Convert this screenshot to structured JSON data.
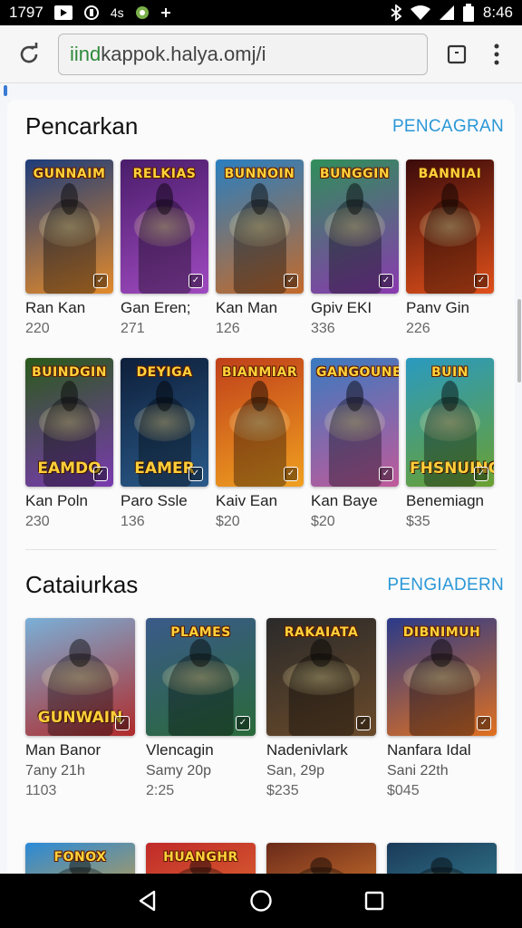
{
  "status_bar": {
    "time_left": "1797",
    "time_right": "8:46",
    "indicator": "4s"
  },
  "browser": {
    "url_prefix": "iind",
    "url_rest": "kappok.halya.omj/i"
  },
  "section1": {
    "title": "Pencarkan",
    "link": "PENCAGRAN",
    "row1": [
      {
        "name": "Ran Kan",
        "num": "220",
        "logo": "GUNNAIM",
        "colors": [
          "#1d3c7a",
          "#e38a2a"
        ]
      },
      {
        "name": "Gan Eren;",
        "num": "271",
        "logo": "RELKIAS",
        "colors": [
          "#4a1d6b",
          "#a04ac0"
        ]
      },
      {
        "name": "Kan Man",
        "num": "126",
        "logo": "BUNNOIN",
        "colors": [
          "#2a7fc0",
          "#c46a2a"
        ]
      },
      {
        "name": "Gpiv EKI",
        "num": "336",
        "logo": "BUNGGIN",
        "colors": [
          "#2f8f5a",
          "#8a3ab0"
        ]
      },
      {
        "name": "Panv Gin",
        "num": "226",
        "logo": "BANNIAI",
        "colors": [
          "#3a0a0a",
          "#e0501a"
        ]
      }
    ],
    "row2": [
      {
        "name": "Kan Poln",
        "num": "230",
        "logo": "BUINDGIN",
        "bottom": "EAMDO",
        "colors": [
          "#2a5a1a",
          "#7a3ab0"
        ]
      },
      {
        "name": "Paro Ssle",
        "num": "136",
        "logo": "DEYIGA",
        "bottom": "EAMER",
        "colors": [
          "#0e1f3a",
          "#2a5a8a"
        ]
      },
      {
        "name": "Kaiv Ean",
        "num": "$20",
        "logo": "BIANMIAR",
        "bottom": "",
        "colors": [
          "#c0401a",
          "#f0a020"
        ]
      },
      {
        "name": "Kan Baye",
        "num": "$20",
        "logo": "GANGOUNEAS",
        "bottom": "",
        "colors": [
          "#3a7ac0",
          "#c05a9a"
        ]
      },
      {
        "name": "Benemiagn",
        "num": "$35",
        "logo": "BUIN",
        "bottom": "FHSNUING",
        "colors": [
          "#2a9ac0",
          "#6aa030"
        ]
      }
    ]
  },
  "section2": {
    "title": "Cataiurkas",
    "link": "PENGIADERN",
    "row": [
      {
        "name": "Man Banor",
        "sub": "7any 21h",
        "num": "1103",
        "logo": "",
        "bottom": "GUNWAIN",
        "colors": [
          "#7ab0d8",
          "#b02a2a"
        ]
      },
      {
        "name": "Vlencagin",
        "sub": "Samy 20p",
        "num": "2:25",
        "logo": "PLAMES",
        "bottom": "",
        "colors": [
          "#3a5a8a",
          "#2a6a3a"
        ]
      },
      {
        "name": "Nadenivlark",
        "sub": "San, 29p",
        "num": "$235",
        "logo": "RAKAIATA",
        "bottom": "",
        "colors": [
          "#2a2a2a",
          "#6a4a2a"
        ]
      },
      {
        "name": "Nanfara Idal",
        "sub": "Sani 22th",
        "num": "$045",
        "logo": "DIBNIMUH",
        "bottom": "",
        "colors": [
          "#2a3a8a",
          "#e07020"
        ]
      }
    ]
  },
  "section3": {
    "row": [
      {
        "logo": "FONOX",
        "colors": [
          "#2a8ad8",
          "#e0a030"
        ]
      },
      {
        "logo": "HUANGHR",
        "colors": [
          "#c02a2a",
          "#e07030"
        ]
      },
      {
        "logo": "",
        "colors": [
          "#6a2a1a",
          "#e08030"
        ]
      },
      {
        "logo": "",
        "colors": [
          "#1a3a5a",
          "#3a8a9a"
        ]
      }
    ]
  }
}
